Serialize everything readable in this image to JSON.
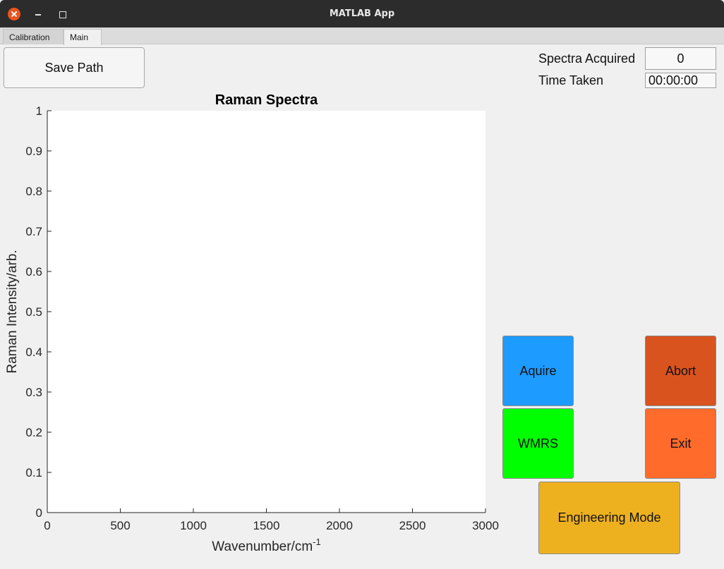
{
  "window": {
    "title": "MATLAB App"
  },
  "tabs": [
    {
      "label": "Calibration"
    },
    {
      "label": "Main"
    }
  ],
  "save_path_button": "Save Path",
  "status": {
    "spectra_label": "Spectra Acquired",
    "spectra_value": "0",
    "time_label": "Time Taken",
    "time_value": "00:00:00"
  },
  "buttons": {
    "acquire": "Aquire",
    "abort": "Abort",
    "wmrs": "WMRS",
    "exit": "Exit",
    "engineering": "Engineering Mode"
  },
  "colors": {
    "acquire": "#1e9bff",
    "abort": "#d9531e",
    "wmrs": "#00ff00",
    "exit": "#ff6b2b",
    "engineering": "#edb120"
  },
  "chart_data": {
    "type": "line",
    "title": "Raman Spectra",
    "xlabel": "Wavenumber/cm",
    "xlabel_sup": "-1",
    "ylabel": "Raman Intensity/arb.",
    "xlim": [
      0,
      3000
    ],
    "ylim": [
      0,
      1
    ],
    "xticks": [
      "0",
      "500",
      "1000",
      "1500",
      "2000",
      "2500",
      "3000"
    ],
    "yticks": [
      "0",
      "0.1",
      "0.2",
      "0.3",
      "0.4",
      "0.5",
      "0.6",
      "0.7",
      "0.8",
      "0.9",
      "1"
    ],
    "series": [],
    "grid": false
  }
}
